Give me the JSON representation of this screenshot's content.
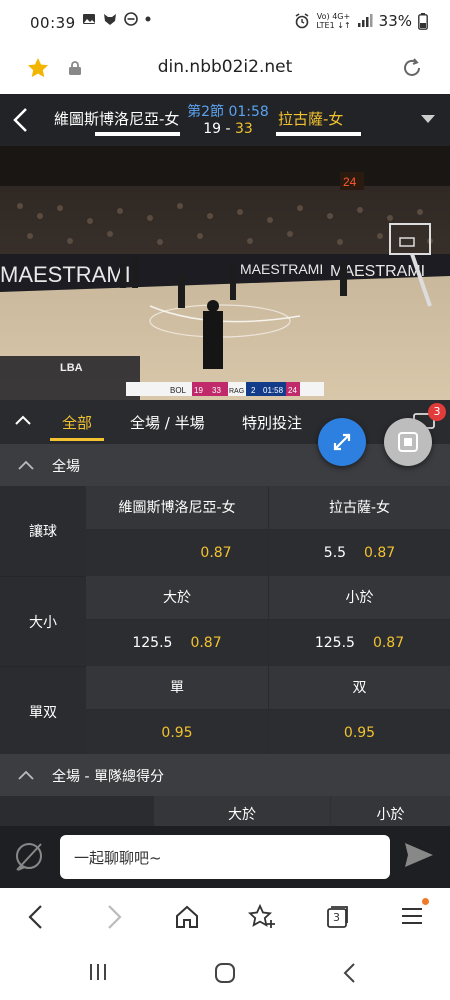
{
  "status_bar": {
    "time": "00:39",
    "network": "VoLTE1 4G+",
    "network_top": "Vo) 4G+",
    "network_bottom": "LTE1 ↓↑",
    "battery": "33%"
  },
  "browser": {
    "url": "din.nbb02i2.net"
  },
  "match": {
    "home_team": "維圖斯博洛尼亞-女",
    "away_team": "拉古薩-女",
    "period": "第2節 01:58",
    "home_score": "19",
    "score_sep": " - ",
    "away_score": "33"
  },
  "video_overlay": {
    "home_abbr": "BOL",
    "home_pts": "19",
    "away_pts": "33",
    "away_abbr": "RAG",
    "quarter": "2",
    "clock": "01:58",
    "shot_clock": "24",
    "arena_banner": "MAESTRAMI",
    "brand": "LBA"
  },
  "tabs": [
    "全部",
    "全場 / 半場",
    "特別投注"
  ],
  "active_tab": 0,
  "notification_badge": "3",
  "section1": {
    "title": "全場",
    "rows": [
      {
        "label": "讓球",
        "headers": [
          "維圖斯博洛尼亞-女",
          "拉古薩-女"
        ],
        "cells": [
          {
            "line": "",
            "odds": "0.87"
          },
          {
            "line": "5.5",
            "odds": "0.87"
          }
        ]
      },
      {
        "label": "大小",
        "headers": [
          "大於",
          "小於"
        ],
        "cells": [
          {
            "line": "125.5",
            "odds": "0.87"
          },
          {
            "line": "125.5",
            "odds": "0.87"
          }
        ]
      },
      {
        "label": "單双",
        "headers": [
          "單",
          "双"
        ],
        "cells": [
          {
            "line": "",
            "odds": "0.95"
          },
          {
            "line": "",
            "odds": "0.95"
          }
        ]
      }
    ]
  },
  "section2": {
    "title": "全場 - 單隊總得分",
    "headers": [
      "大於",
      "小於"
    ]
  },
  "chat": {
    "placeholder": "一起聊聊吧~"
  },
  "browser_nav": {
    "tabs_count": "3"
  },
  "colors": {
    "accent_gold": "#f2c230",
    "period_blue": "#5aa3f0",
    "fab_blue": "#2d7fe0",
    "dark_bg": "#2f3034"
  }
}
